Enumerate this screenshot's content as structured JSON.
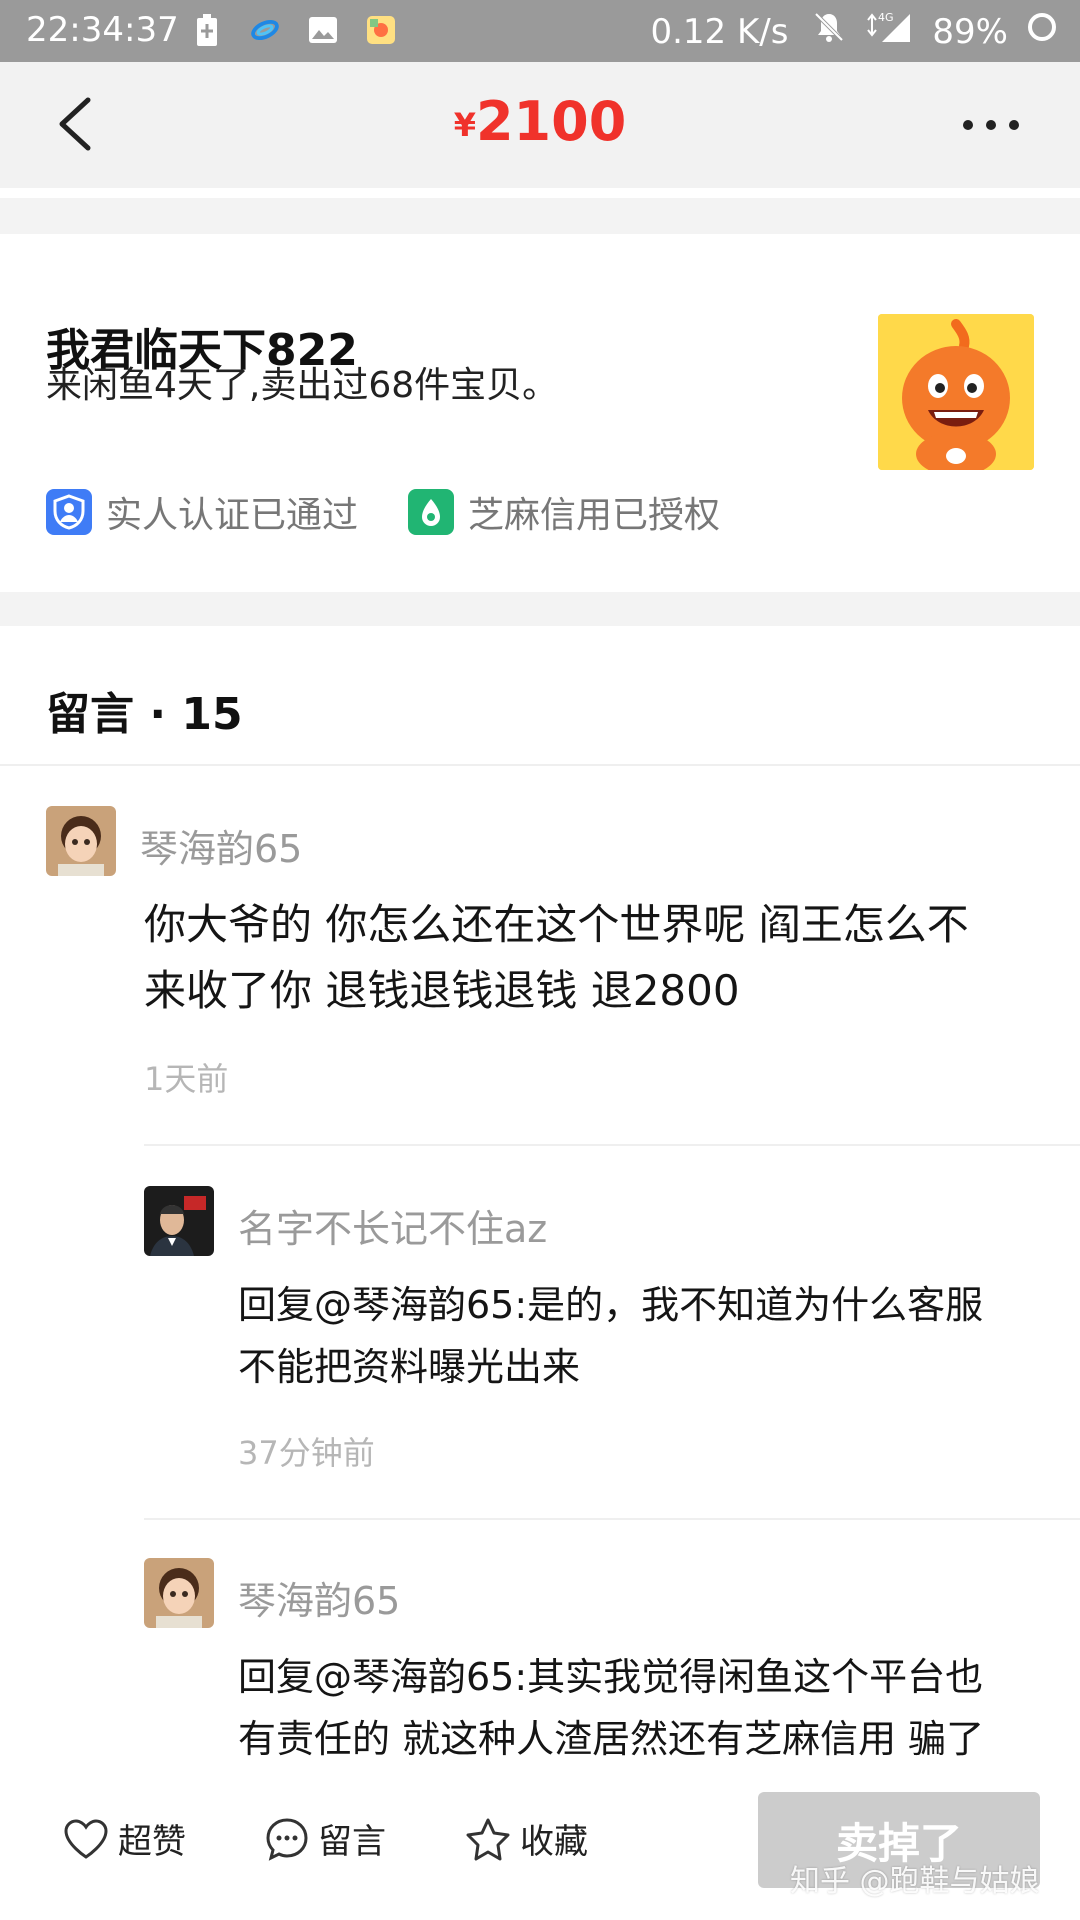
{
  "status_bar": {
    "time": "22:34:37",
    "net_speed": "0.12 K/s",
    "network": "4G",
    "battery": "89%"
  },
  "header": {
    "currency": "¥",
    "price": "2100"
  },
  "seller": {
    "name": "我君临天下822",
    "description": "来闲鱼4天了,卖出过68件宝贝。",
    "badges": [
      {
        "label": "实人认证已通过",
        "icon": "person-verify-icon",
        "color": "#3f7cf6"
      },
      {
        "label": "芝麻信用已授权",
        "icon": "sesame-credit-icon",
        "color": "#21b573"
      }
    ]
  },
  "comments": {
    "title": "留言 · 15",
    "items": [
      {
        "user": "琴海韵65",
        "text_lines": [
          "你大爷的 你怎么还在这个世界呢 阎王怎么不",
          "来收了你 退钱退钱退钱 退2800"
        ],
        "time": "1天前"
      },
      {
        "user": "名字不长记不住az",
        "text_lines": [
          "回复@琴海韵65:是的，我不知道为什么客服",
          "不能把资料曝光出来"
        ],
        "time": "37分钟前"
      },
      {
        "user": "琴海韵65",
        "text_lines": [
          "回复@琴海韵65:其实我觉得闲鱼这个平台也",
          "有责任的 就这种人渣居然还有芝麻信用 骗了"
        ],
        "time": ""
      }
    ]
  },
  "bottom_bar": {
    "like": "超赞",
    "comment": "留言",
    "favorite": "收藏",
    "sold": "卖掉了"
  },
  "watermark": "知乎 @跑鞋与姑娘",
  "colors": {
    "price_red": "#f0322b",
    "status_bar": "#9a9a9a",
    "sold_button": "#cccccc"
  }
}
